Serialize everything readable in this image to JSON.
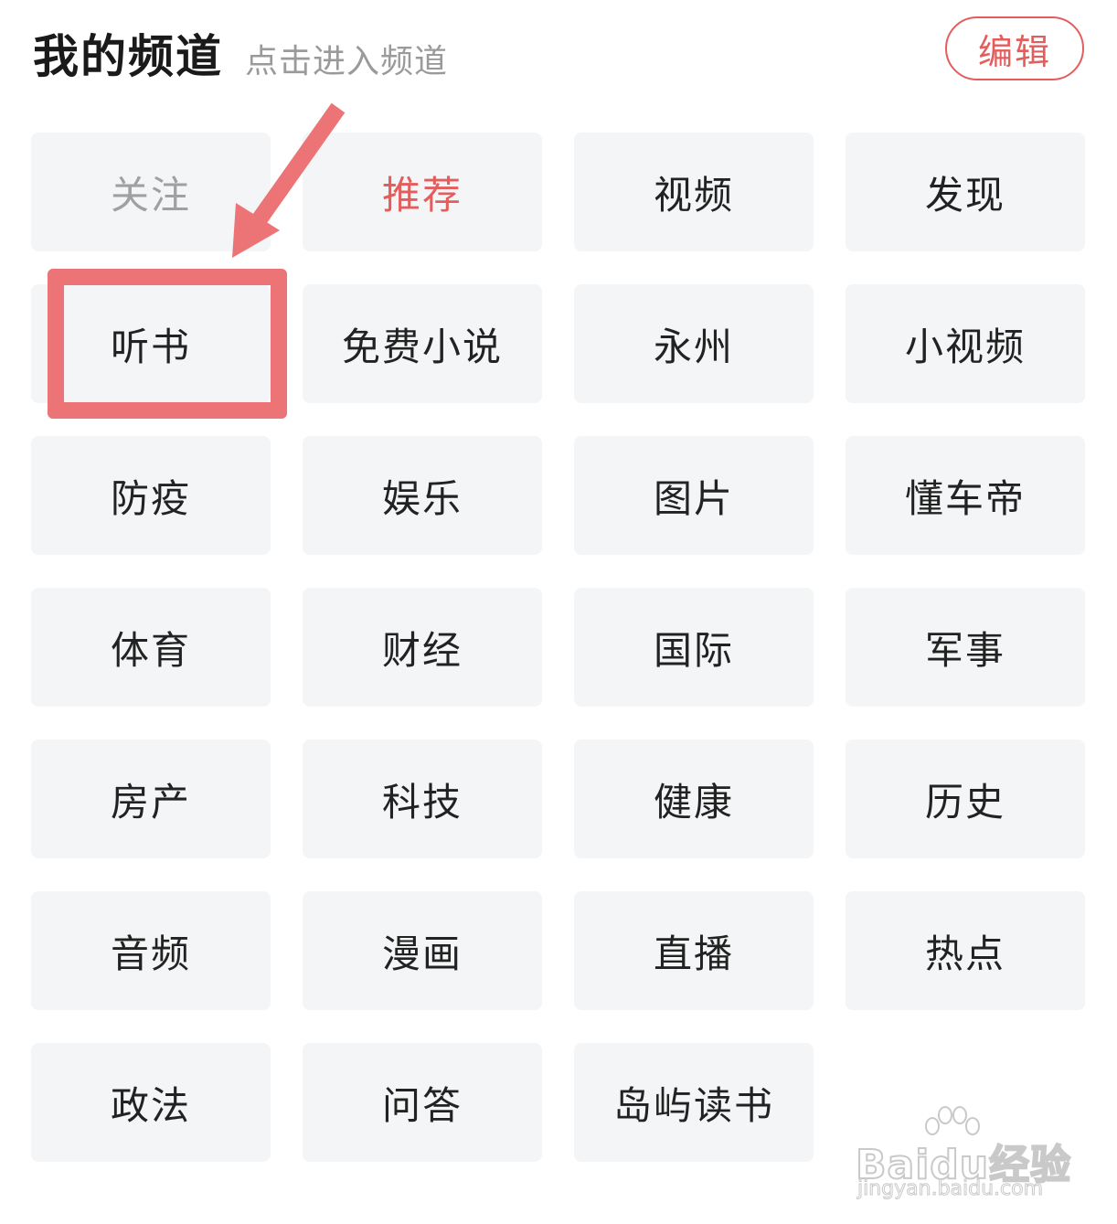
{
  "header": {
    "title": "我的频道",
    "subtitle": "点击进入频道",
    "edit_label": "编辑"
  },
  "channels": [
    {
      "label": "关注",
      "state": "disabled"
    },
    {
      "label": "推荐",
      "state": "active"
    },
    {
      "label": "视频",
      "state": "normal"
    },
    {
      "label": "发现",
      "state": "normal"
    },
    {
      "label": "听书",
      "state": "normal"
    },
    {
      "label": "免费小说",
      "state": "normal"
    },
    {
      "label": "永州",
      "state": "normal"
    },
    {
      "label": "小视频",
      "state": "normal"
    },
    {
      "label": "防疫",
      "state": "normal"
    },
    {
      "label": "娱乐",
      "state": "normal"
    },
    {
      "label": "图片",
      "state": "normal"
    },
    {
      "label": "懂车帝",
      "state": "normal"
    },
    {
      "label": "体育",
      "state": "normal"
    },
    {
      "label": "财经",
      "state": "normal"
    },
    {
      "label": "国际",
      "state": "normal"
    },
    {
      "label": "军事",
      "state": "normal"
    },
    {
      "label": "房产",
      "state": "normal"
    },
    {
      "label": "科技",
      "state": "normal"
    },
    {
      "label": "健康",
      "state": "normal"
    },
    {
      "label": "历史",
      "state": "normal"
    },
    {
      "label": "音频",
      "state": "normal"
    },
    {
      "label": "漫画",
      "state": "normal"
    },
    {
      "label": "直播",
      "state": "normal"
    },
    {
      "label": "热点",
      "state": "normal"
    },
    {
      "label": "政法",
      "state": "normal"
    },
    {
      "label": "问答",
      "state": "normal"
    },
    {
      "label": "岛屿读书",
      "state": "normal"
    }
  ],
  "annotation": {
    "highlighted_channel": "听书",
    "color": "#ec7476"
  },
  "watermark": {
    "logo_text": "Baidu经验",
    "url_text": "jingyan.baidu.com"
  },
  "colors": {
    "accent": "#e35d5d",
    "chip_bg": "#f4f5f6",
    "text": "#222222",
    "muted": "#a0a0a0"
  }
}
